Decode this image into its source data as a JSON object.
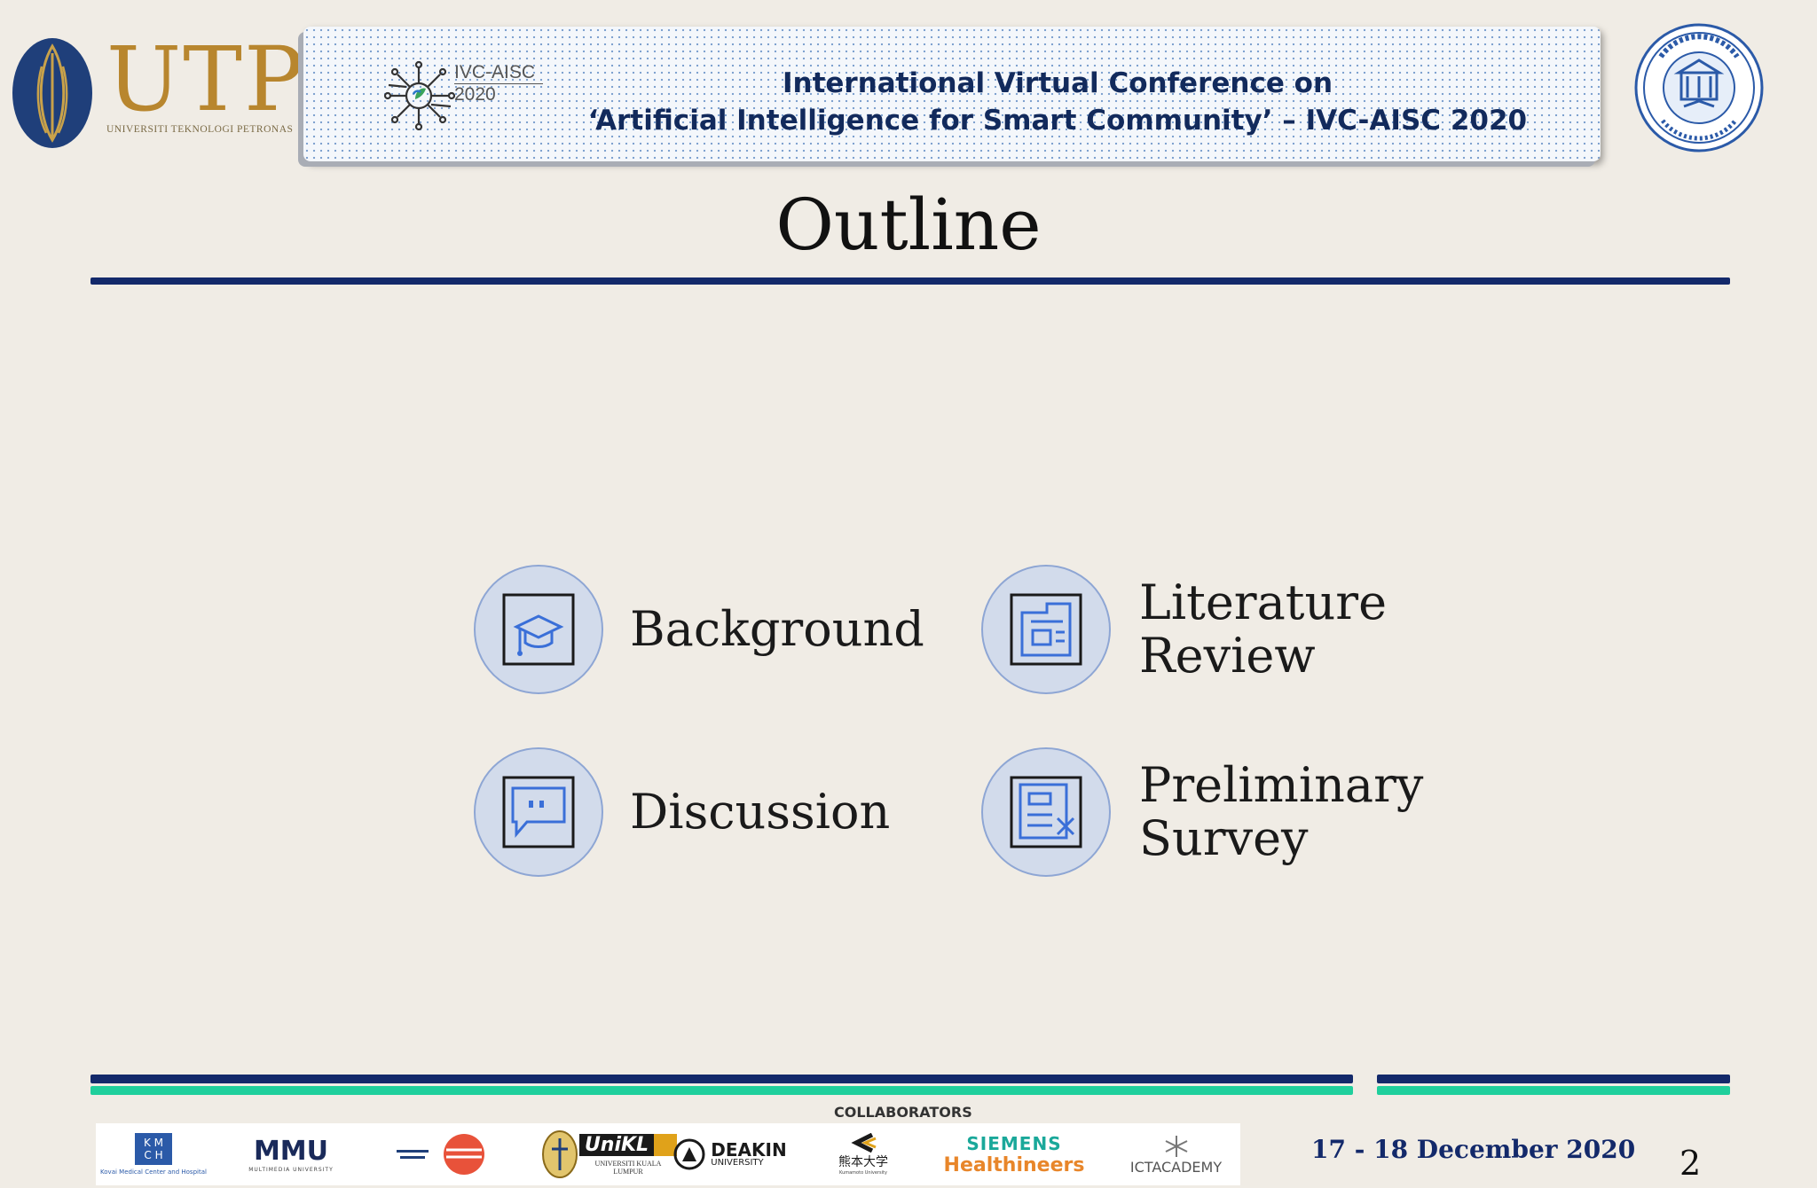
{
  "header": {
    "utp": {
      "text": "UTP",
      "subtitle": "UNIVERSITI TEKNOLOGI PETRONAS"
    },
    "ivc_logo": {
      "name": "IVC-AISC",
      "year": "2020"
    },
    "conference": {
      "line1": "International Virtual Conference on",
      "line2": "‘Artificial Intelligence for Smart Community’ – IVC-AISC 2020"
    },
    "right_seal_icon": "institute-seal-icon"
  },
  "slide": {
    "title": "Outline",
    "items": [
      {
        "label": "Background",
        "icon": "graduation-cap-icon"
      },
      {
        "label_line1": "Literature",
        "label_line2": "Review",
        "icon": "document-layout-icon"
      },
      {
        "label": "Discussion",
        "icon": "chat-bubble-icon"
      },
      {
        "label_line1": "Preliminary",
        "label_line2": "Survey",
        "icon": "form-edit-icon"
      }
    ]
  },
  "footer": {
    "collaborators_label": "COLLABORATORS",
    "logos": [
      {
        "text": "K M C H",
        "caption": "Kovai Medical Center and Hospital"
      },
      {
        "text": "MMU",
        "caption": "MULTIMEDIA UNIVERSITY"
      },
      {
        "text": ""
      },
      {
        "text": "UniKL",
        "caption": "UNIVERSITI KUALA LUMPUR"
      },
      {
        "text": "DEAKIN",
        "caption": "UNIVERSITY"
      },
      {
        "text": "熊本大学",
        "caption": "Kumamoto University"
      },
      {
        "text": "SIEMENS",
        "caption": "Healthineers"
      },
      {
        "text": "ICTACADEMY"
      }
    ],
    "date": "17 - 18 December 2020",
    "page_number": "2"
  },
  "colors": {
    "navy": "#13296a",
    "teal": "#1fcf9c",
    "gold": "#b8862e",
    "circle_fill": "#d2dbeb",
    "icon_blue": "#3a6fd8"
  }
}
